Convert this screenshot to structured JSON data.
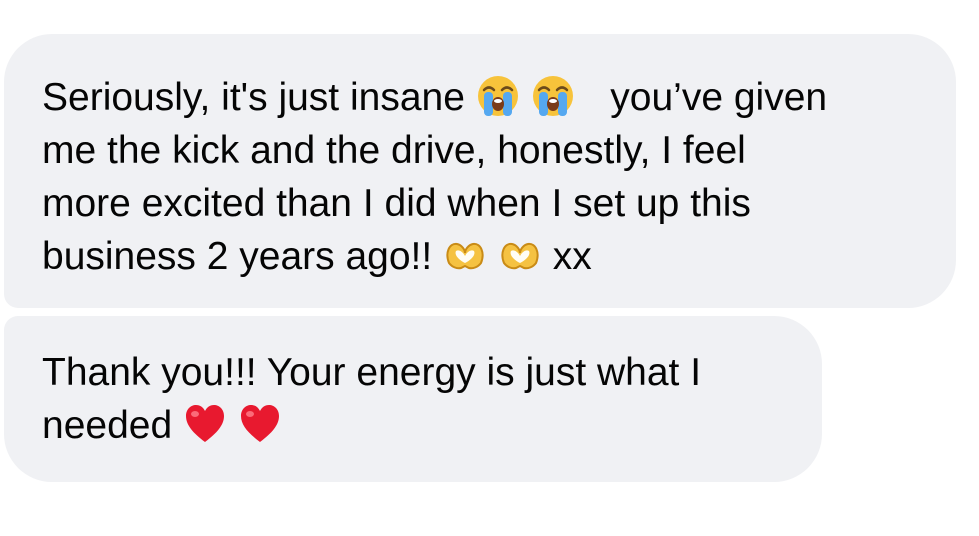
{
  "messages": [
    {
      "lines": [
        {
          "text_a": "Seriously, it's just insane",
          "emoji_a": "loudly-crying-face",
          "emoji_b": "loudly-crying-face",
          "text_b": "you’ve given"
        },
        {
          "text": "me the kick and the drive, honestly, I feel"
        },
        {
          "text": "more excited than I did when I set up this"
        },
        {
          "text_a": "business 2 years ago!!",
          "emoji_a": "heart-hands",
          "emoji_b": "heart-hands",
          "text_b": "xx"
        }
      ]
    },
    {
      "lines": [
        {
          "text": "Thank you!!! Your energy is just what I"
        },
        {
          "text_a": "needed",
          "emoji_a": "red-heart",
          "emoji_b": "red-heart"
        }
      ]
    }
  ],
  "colors": {
    "bubble_background": "#f0f1f4",
    "text": "#050505"
  }
}
